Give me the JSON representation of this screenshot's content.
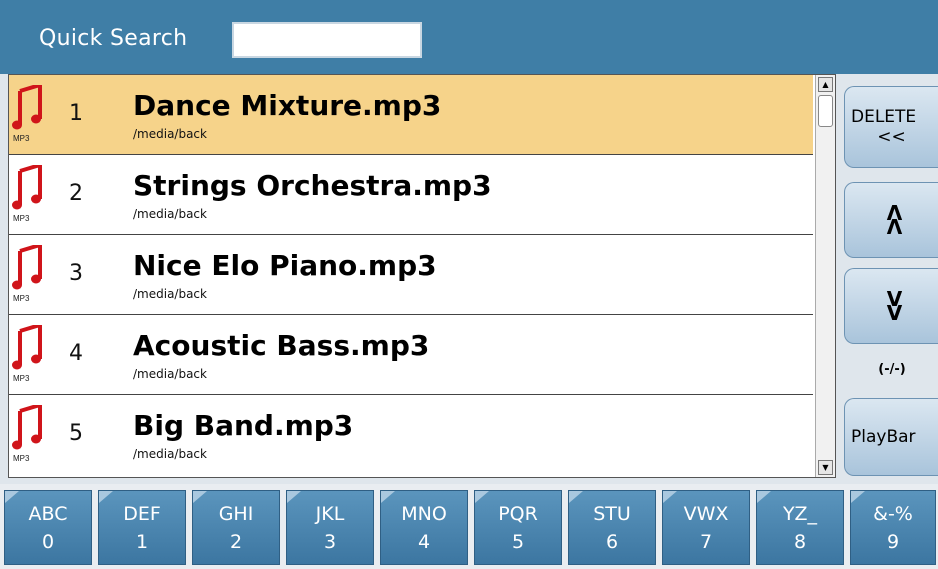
{
  "header": {
    "quick_search_label": "Quick Search",
    "quick_search_value": ""
  },
  "list": {
    "selected_index": 0,
    "items": [
      {
        "number": "1",
        "title": "Dance Mixture.mp3",
        "path": "/media/back",
        "type_label": "MP3",
        "icon": "music-note-icon"
      },
      {
        "number": "2",
        "title": "Strings Orchestra.mp3",
        "path": "/media/back",
        "type_label": "MP3",
        "icon": "music-note-icon"
      },
      {
        "number": "3",
        "title": "Nice Elo Piano.mp3",
        "path": "/media/back",
        "type_label": "MP3",
        "icon": "music-note-icon"
      },
      {
        "number": "4",
        "title": "Acoustic Bass.mp3",
        "path": "/media/back",
        "type_label": "MP3",
        "icon": "music-note-icon"
      },
      {
        "number": "5",
        "title": "Big Band.mp3",
        "path": "/media/back",
        "type_label": "MP3",
        "icon": "music-note-icon"
      }
    ]
  },
  "side_buttons": {
    "delete_label": "DELETE",
    "delete_sub": "<<",
    "page_up_glyph": "^",
    "page_down_glyph": "v",
    "page_indicator": "(-/-)",
    "playbar_label": "PlayBar"
  },
  "keys": [
    {
      "letters": "ABC",
      "digit": "0"
    },
    {
      "letters": "DEF",
      "digit": "1"
    },
    {
      "letters": "GHI",
      "digit": "2"
    },
    {
      "letters": "JKL",
      "digit": "3"
    },
    {
      "letters": "MNO",
      "digit": "4"
    },
    {
      "letters": "PQR",
      "digit": "5"
    },
    {
      "letters": "STU",
      "digit": "6"
    },
    {
      "letters": "VWX",
      "digit": "7"
    },
    {
      "letters": "YZ_",
      "digit": "8"
    },
    {
      "letters": "&-%",
      "digit": "9"
    }
  ],
  "colors": {
    "header_bg": "#3f7ea6",
    "selected_row": "#f6d38a",
    "note_red": "#d0141a",
    "key_blue": "#4a86b0"
  }
}
